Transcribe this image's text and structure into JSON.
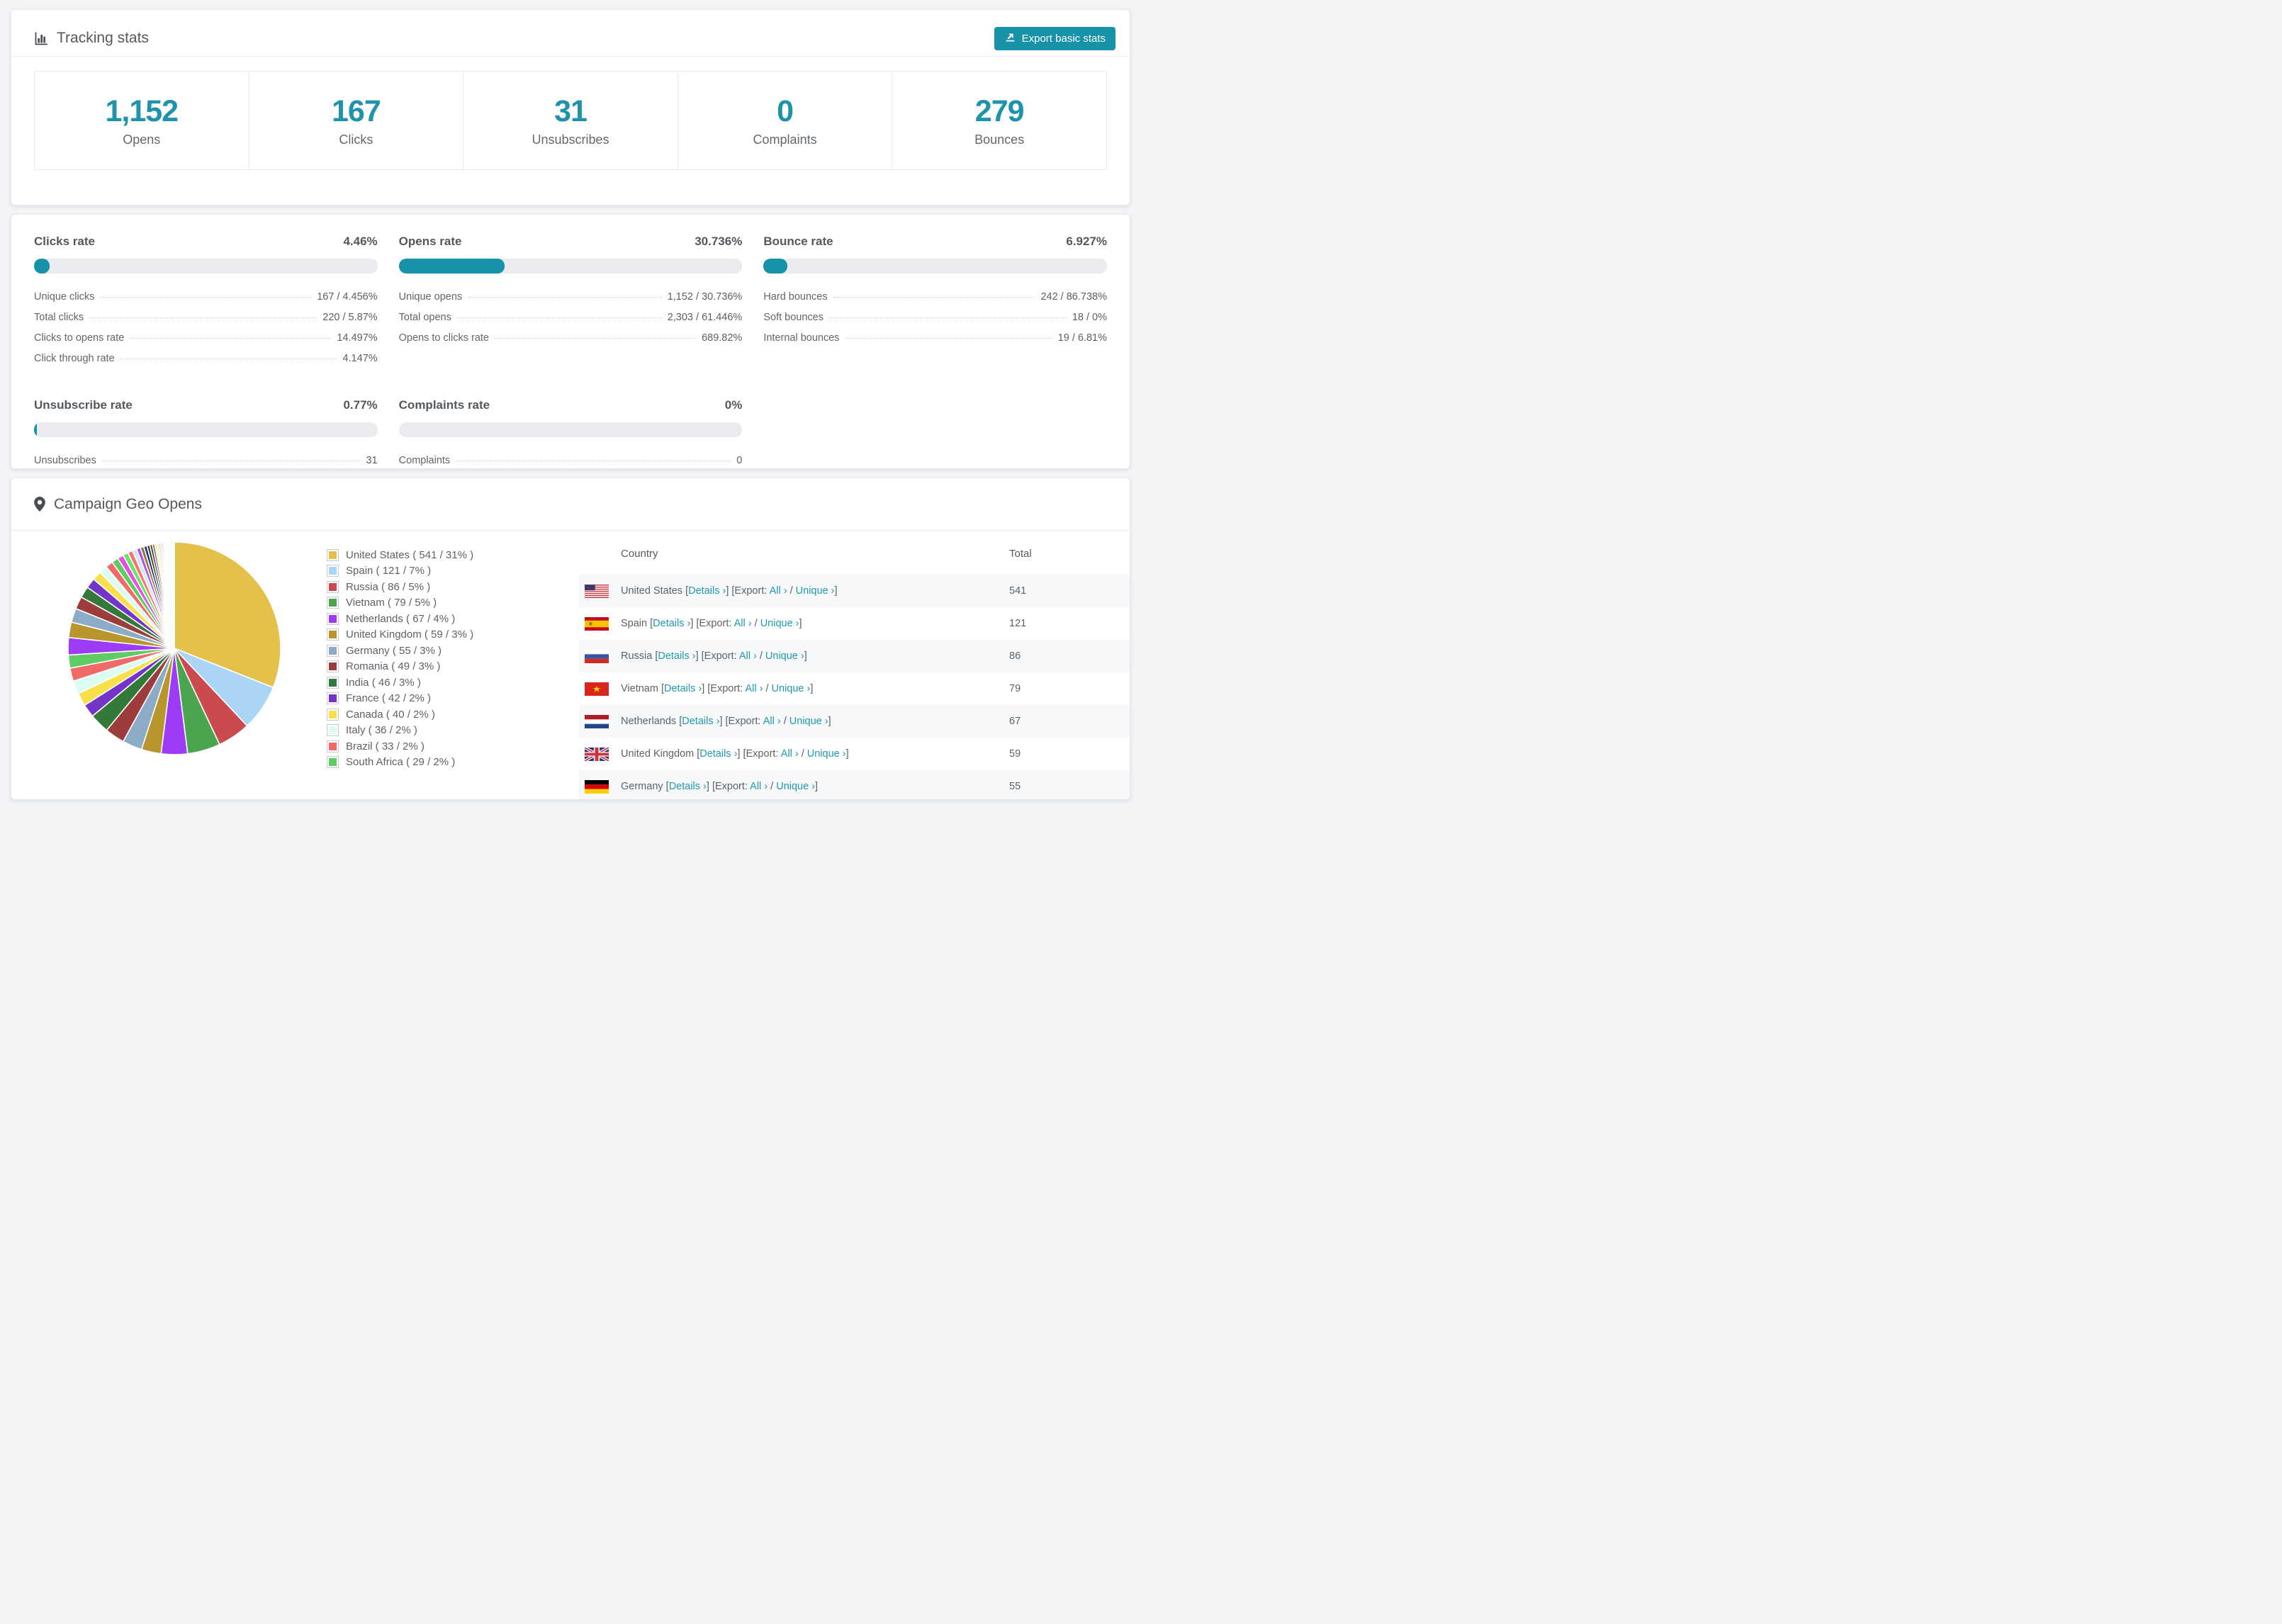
{
  "header": {
    "title": "Tracking stats",
    "export_label": "Export basic stats"
  },
  "summary": [
    {
      "value": "1,152",
      "label": "Opens"
    },
    {
      "value": "167",
      "label": "Clicks"
    },
    {
      "value": "31",
      "label": "Unsubscribes"
    },
    {
      "value": "0",
      "label": "Complaints"
    },
    {
      "value": "279",
      "label": "Bounces"
    }
  ],
  "rates": [
    {
      "title": "Clicks rate",
      "value": "4.46%",
      "pct": 4.46,
      "rows": [
        [
          "Unique clicks",
          "167 / 4.456%"
        ],
        [
          "Total clicks",
          "220 / 5.87%"
        ],
        [
          "Clicks to opens rate",
          "14.497%"
        ],
        [
          "Click through rate",
          "4.147%"
        ]
      ]
    },
    {
      "title": "Opens rate",
      "value": "30.736%",
      "pct": 30.736,
      "rows": [
        [
          "Unique opens",
          "1,152 / 30.736%"
        ],
        [
          "Total opens",
          "2,303 / 61.446%"
        ],
        [
          "Opens to clicks rate",
          "689.82%"
        ]
      ]
    },
    {
      "title": "Bounce rate",
      "value": "6.927%",
      "pct": 6.927,
      "rows": [
        [
          "Hard bounces",
          "242 / 86.738%"
        ],
        [
          "Soft bounces",
          "18 / 0%"
        ],
        [
          "Internal bounces",
          "19 / 6.81%"
        ]
      ]
    },
    {
      "title": "Unsubscribe rate",
      "value": "0.77%",
      "pct": 0.77,
      "rows": [
        [
          "Unsubscribes",
          "31"
        ]
      ]
    },
    {
      "title": "Complaints rate",
      "value": "0%",
      "pct": 0,
      "rows": [
        [
          "Complaints",
          "0"
        ]
      ]
    }
  ],
  "geo": {
    "title": "Campaign Geo Opens",
    "table_headers": {
      "country": "Country",
      "total": "Total"
    },
    "tokens": {
      "bracket_open": "[",
      "bracket_close": "]",
      "details": "Details ›",
      "export_prefix": "[Export:",
      "all": "All ›",
      "slash": "/",
      "unique": "Unique ›"
    },
    "legend": [
      "United States ( 541 / 31% )",
      "Spain ( 121 / 7% )",
      "Russia ( 86 / 5% )",
      "Vietnam ( 79 / 5% )",
      "Netherlands ( 67 / 4% )",
      "United Kingdom ( 59 / 3% )",
      "Germany ( 55 / 3% )",
      "Romania ( 49 / 3% )",
      "India ( 46 / 3% )",
      "France ( 42 / 2% )",
      "Canada ( 40 / 2% )",
      "Italy ( 36 / 2% )",
      "Brazil ( 33 / 2% )",
      "South Africa ( 29 / 2% )"
    ],
    "rows": [
      {
        "country": "United States",
        "flag": "us",
        "total": "541"
      },
      {
        "country": "Spain",
        "flag": "es",
        "total": "121"
      },
      {
        "country": "Russia",
        "flag": "ru",
        "total": "86"
      },
      {
        "country": "Vietnam",
        "flag": "vn",
        "total": "79"
      },
      {
        "country": "Netherlands",
        "flag": "nl",
        "total": "67"
      },
      {
        "country": "United Kingdom",
        "flag": "gb",
        "total": "59"
      },
      {
        "country": "Germany",
        "flag": "de",
        "total": "55"
      }
    ]
  },
  "chart_data": {
    "type": "pie",
    "title": "Campaign Geo Opens",
    "legend_position": "right",
    "series": [
      {
        "name": "United States",
        "value": 541,
        "pct": 31,
        "color": "#e3c14b"
      },
      {
        "name": "Spain",
        "value": 121,
        "pct": 7,
        "color": "#abd5f5"
      },
      {
        "name": "Russia",
        "value": 86,
        "pct": 5,
        "color": "#cb4a4d"
      },
      {
        "name": "Vietnam",
        "value": 79,
        "pct": 5,
        "color": "#4aa54e"
      },
      {
        "name": "Netherlands",
        "value": 67,
        "pct": 4,
        "color": "#9d3bf7"
      },
      {
        "name": "United Kingdom",
        "value": 59,
        "pct": 3,
        "color": "#b9962d"
      },
      {
        "name": "Germany",
        "value": 55,
        "pct": 3,
        "color": "#8cabc6"
      },
      {
        "name": "Romania",
        "value": 49,
        "pct": 3,
        "color": "#9d3c3c"
      },
      {
        "name": "India",
        "value": 46,
        "pct": 3,
        "color": "#33793a"
      },
      {
        "name": "France",
        "value": 42,
        "pct": 2,
        "color": "#7434c8"
      },
      {
        "name": "Canada",
        "value": 40,
        "pct": 2,
        "color": "#f8e04b"
      },
      {
        "name": "Italy",
        "value": 36,
        "pct": 2,
        "color": "#dbfbf3"
      },
      {
        "name": "Brazil",
        "value": 33,
        "pct": 2,
        "color": "#f06a6a"
      },
      {
        "name": "South Africa",
        "value": 29,
        "pct": 2,
        "color": "#5ecb63"
      }
    ],
    "others": {
      "note": "many small unlabeled country slices",
      "total_pct": 26,
      "display_slices": 46,
      "decay": 0.9
    },
    "start_angle_deg": -90,
    "direction": "clockwise",
    "palette": [
      "#e3c14b",
      "#abd5f5",
      "#cb4a4d",
      "#4aa54e",
      "#9d3bf7",
      "#b9962d",
      "#8cabc6",
      "#9d3c3c",
      "#33793a",
      "#7434c8",
      "#f8e04b",
      "#dbfbf3",
      "#f06a6a",
      "#5ecb63",
      "#e44fe4",
      "#67e667",
      "#ff7070",
      "#cfe6fa",
      "#b052ec",
      "#8f7a30",
      "#2d2d86",
      "#1d4f24",
      "#7c2626",
      "#51708e",
      "#fbfb4e",
      "#e8e2da"
    ]
  }
}
